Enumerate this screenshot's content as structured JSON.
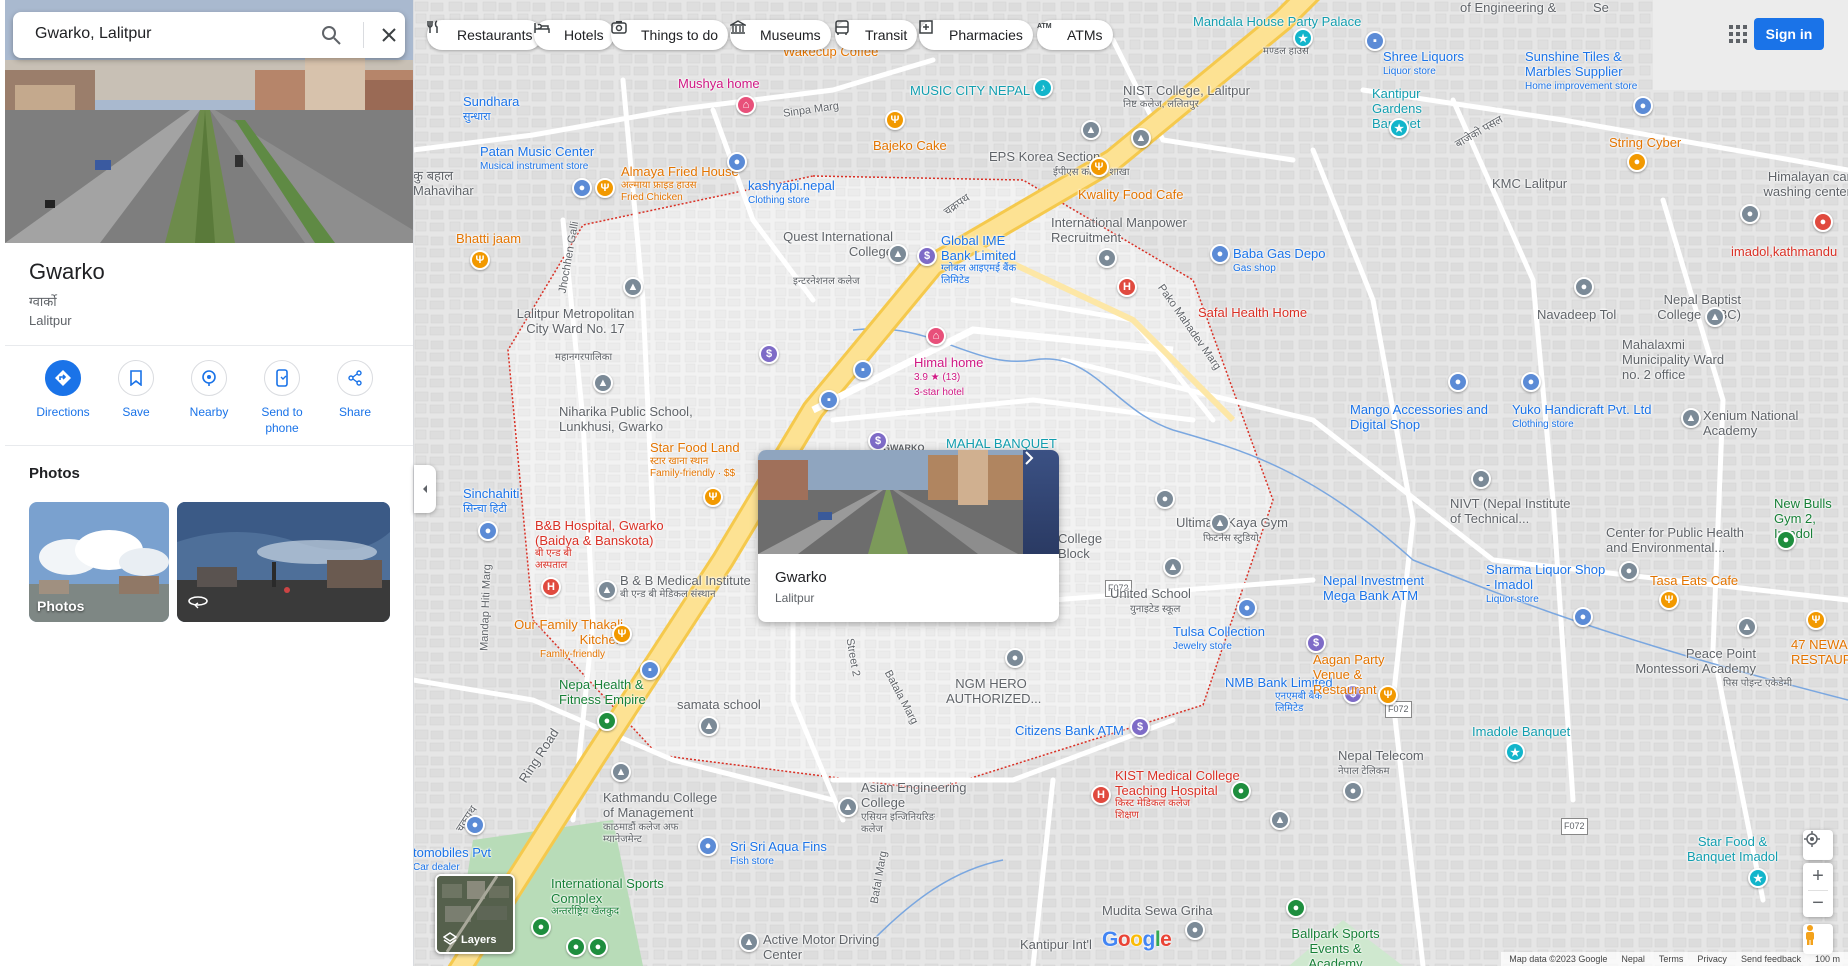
{
  "search": {
    "value": "Gwarko, Lalitpur"
  },
  "place": {
    "title": "Gwarko",
    "local_name": "ग्वार्को",
    "subtitle": "Lalitpur"
  },
  "actions": [
    {
      "label": "Directions"
    },
    {
      "label": "Save"
    },
    {
      "label": "Nearby"
    },
    {
      "label": "Send to phone"
    },
    {
      "label": "Share"
    }
  ],
  "photos": {
    "heading": "Photos",
    "items": [
      {
        "label": "Photos"
      },
      {
        "label": ""
      }
    ]
  },
  "chips": [
    {
      "label": "Restaurants",
      "icon": "fork-knife-icon"
    },
    {
      "label": "Hotels",
      "icon": "bed-icon"
    },
    {
      "label": "Things to do",
      "icon": "camera-icon"
    },
    {
      "label": "Museums",
      "icon": "museum-icon"
    },
    {
      "label": "Transit",
      "icon": "bus-icon"
    },
    {
      "label": "Pharmacies",
      "icon": "pharmacy-icon"
    },
    {
      "label": "ATMs",
      "icon": "atm-icon"
    }
  ],
  "header": {
    "sign_in": "Sign in"
  },
  "card": {
    "title": "Gwarko",
    "subtitle": "Lalitpur"
  },
  "layers": {
    "label": "Layers"
  },
  "logo": {
    "text": "Google",
    "colors": [
      "#4285f4",
      "#ea4335",
      "#fbbc05",
      "#4285f4",
      "#34a853",
      "#ea4335"
    ]
  },
  "attribution": [
    "Map data ©2023 Google",
    "Nepal",
    "Terms",
    "Privacy",
    "Send feedback",
    "100 m"
  ],
  "roads": {
    "ring_road": "Ring Road",
    "chakrapath_1": "चक्रपथ",
    "chakrapath_2": "चक्रपथ",
    "sinpa_marg": "Sinpa Marg",
    "pako_mahadev": "Pako Mahadev Marg",
    "mandap_hiti": "Mandap Hiti Marg",
    "jhochhen_galli": "Jhochhen Galli",
    "street2": "Street 2",
    "batala_marg": "Batala Marg",
    "bafal_marg": "Bafal Marg",
    "f072_a": "F072",
    "f072_b": "F072",
    "f072_c": "F072",
    "road_badge": "GWARKO"
  },
  "map_labels": {
    "mandala": "Mandala House Party Palace",
    "mandala_np": "मण्डल हाउस",
    "mushya": "Mushya home",
    "wakecup": "Wakecup Coffee",
    "music_city": "MUSIC CITY NEPAL",
    "nist": "NIST College, Lalitpur",
    "nist_np": "निष्ट कलेज, ललितपुर",
    "sundhara": "Sundhara",
    "sundhara_np": "सुन्धारा",
    "bajeko": "Bajeko Cake",
    "eps": "EPS Korea Section",
    "eps_np": "ईपीएस कोरिया शाखा",
    "patan_music": "Patan Music Center",
    "patan_music_sub": "Musical instrument store",
    "almaya": "Almaya Fried House",
    "almaya_np": "अल्माया फ्राइड हाउस",
    "almaya_sub": "Fried Chicken",
    "kashyapi": "kashyapi.nepal",
    "kashyapi_sub": "Clothing store",
    "mahavihar": "कु बहाल Mahavihar",
    "bhatti": "Bhatti jaam",
    "quest": "Quest International College",
    "quest_np": "इन्टरनेशनल कलेज",
    "global_ime": "Global IME Bank Limited",
    "global_ime_np": "ग्लोबल आइएमई बैंक लिमिटेड",
    "kwality": "Kwality Food Cafe",
    "intl_manpower": "International Manpower Recruitment",
    "baba_gas": "Baba Gas Depo",
    "baba_gas_sub": "Gas shop",
    "lalitpur_ward": "Lalitpur Metropolitan City Ward No. 17",
    "lalitpur_ward_np": "महानगरपालिका",
    "safal": "Safal Health Home",
    "himal": "Himal home",
    "himal_rating": "3.9 ★ (13)",
    "himal_class": "3-star hotel",
    "niharika": "Niharika Public School, Lunkhusi, Gwarko",
    "star_food": "Star Food Land",
    "star_food_np": "स्टार खाना स्थान",
    "star_food_sub": "Family-friendly · $$",
    "mahal": "MAHAL BANQUET",
    "sinchahiti": "Sinchahiti",
    "sinchahiti_np": "सिन्चा हिटी",
    "bb_hospital": "B&B Hospital, Gwarko (Baidya & Banskota)",
    "bb_hospital_np": "बी एन्ड बी अस्पताल",
    "bb_medical": "B & B Medical Institute",
    "bb_medical_np": "बी एन्ड बी मेडिकल संस्थान",
    "our_family": "Our Family Thakali Kitchen",
    "our_family_sub": "Family-friendly",
    "college_block": "College Block",
    "ultimate": "Ultimate Kaya Gym",
    "ultimate_np": "फिटनेस स्टुडियो",
    "united": "United School",
    "united_np": "युनाइटेड स्कूल",
    "tulsa": "Tulsa Collection",
    "tulsa_sub": "Jewelry store",
    "nepa_health": "Nepa Health & Fitness Empire",
    "samata": "samata school",
    "ngm": "NGM HERO AUTHORIZED...",
    "citizens": "Citizens Bank ATM",
    "asian": "Asian Engineering College",
    "asian_np": "एसियन इन्जिनियरिङ कलेज",
    "kathmandu_college": "Kathmandu College of Management",
    "kathmandu_college_np": "काठमाडौं कलेज अफ म्यानेजमेन्ट",
    "sri_sri": "Sri Sri Aqua Fins",
    "sri_sri_sub": "Fish store",
    "intl_sports": "International Sports Complex",
    "intl_sports_np": "अन्तर्राष्ट्रिय खेलकुद",
    "automobiles": "tomobiles Pvt",
    "automobiles_sub": "Car dealer",
    "active_motor": "Active Motor Driving Center",
    "kantipur_intl": "Kantipur Int'l",
    "mudita": "Mudita Sewa Griha",
    "ballpark": "Ballpark Sports Events & Academy",
    "kist": "KIST Medical College Teaching Hospital",
    "kist_np": "किस्ट मेडिकल कलेज शिक्षण",
    "nepal_telecom": "Nepal Telecom",
    "nepal_telecom_np": "नेपाल टेलिकम",
    "nmb": "NMB Bank Limited",
    "nmb_np": "एनएमबी बैंक लिमिटेड",
    "aagan": "Aagan Party Venue & Restaurant",
    "imadole_banquet": "Imadole Banquet",
    "nepal_investment": "Nepal Investment Mega Bank ATM",
    "sharma": "Sharma Liquor Shop - Imadol",
    "sharma_sub": "Liquor store",
    "tasa": "Tasa Eats Cafe",
    "peace_point": "Peace Point Montessori Academy",
    "peace_point_np": "पिस पोइन्ट एकेडेमी",
    "newa": "47 NEWA RESTAURA",
    "star_food_banquet": "Star Food & Banquet Imadol",
    "center_public": "Center for Public Health and Environmental...",
    "nivt": "NIVT (Nepal Institute of Technical...",
    "new_bulls": "New Bulls Gym 2, Imadol",
    "mango": "Mango Accessories and Digital Shop",
    "yuko": "Yuko Handicraft Pvt. Ltd",
    "yuko_sub": "Clothing store",
    "xenium": "Xenium National Academy",
    "mahalaxmi": "Mahalaxmi Municipality Ward no. 2 office",
    "navadeep": "Navadeep Tol",
    "nepal_baptist": "Nepal Baptist College (NBC)",
    "imadol_kathmandu": "imadol,kathmandu",
    "himalayan_car": "Himalayan car washing center",
    "kmc": "KMC Lalitpur",
    "string_cyber": "String Cyber",
    "kantipur_gardens": "Kantipur Gardens Banquet",
    "shree_liquors": "Shree Liquors",
    "shree_liquors_sub": "Liquor store",
    "sunshine": "Sunshine Tiles & Marbles Supplier",
    "sunshine_sub": "Home improvement store",
    "engineering": "of Engineering &",
    "gwarko_college": "Se",
    "bajeko_np": "बाजेको पसल"
  }
}
